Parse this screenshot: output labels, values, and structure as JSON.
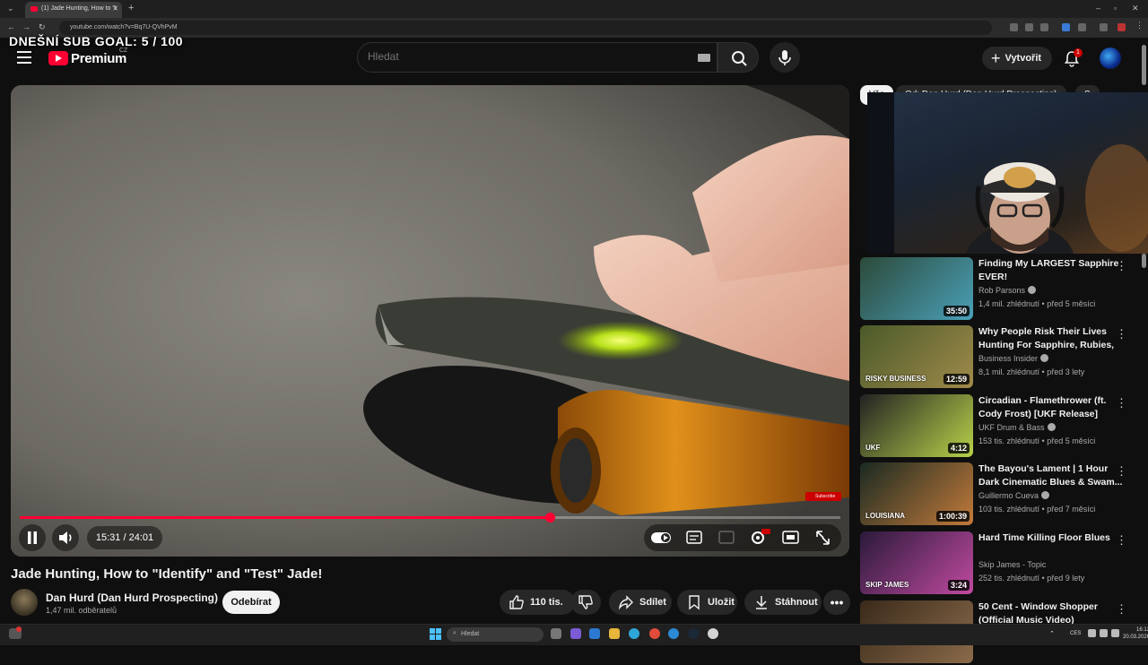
{
  "browser": {
    "tab_title": "(1) Jade Hunting, How to \"I",
    "url": "youtube.com/watch?v=Bq7U-QVhPvM"
  },
  "overlay": {
    "sub_goal": "DNEŠNÍ SUB GOAL:  5 / 100"
  },
  "header": {
    "logo_text": "Premium",
    "logo_country": "CZ",
    "search_placeholder": "Hledat",
    "create_label": "Vytvořit",
    "notification_count": "1"
  },
  "player": {
    "time": "15:31 / 24:01",
    "progress": 0.646,
    "subscribe_watermark": "Subscribe"
  },
  "video": {
    "title": "Jade Hunting, How to \"Identify\" and \"Test\" Jade!",
    "channel": "Dan Hurd (Dan Hurd Prospecting)",
    "subscribers": "1,47 mil. odběratelů",
    "subscribe_label": "Odebírat",
    "likes": "110 tis.",
    "share_label": "Sdílet",
    "save_label": "Uložit",
    "download_label": "Stáhnout"
  },
  "sidebar": {
    "chips": [
      "Vše",
      "Od: Dan Hurd (Dan Hurd Prospecting)",
      "S"
    ],
    "recommendations": [
      {
        "title": "Finding My LARGEST Sapphire EVER!",
        "channel": "Rob Parsons",
        "verified": true,
        "meta": "1,4 mil. zhlédnutí • před 5 měsíci",
        "duration": "35:50",
        "thumb_colors": [
          "#2c4a3a",
          "#4aa0b8"
        ]
      },
      {
        "title": "Why People Risk Their Lives Hunting For Sapphire, Rubies, ...",
        "channel": "Business Insider",
        "verified": true,
        "meta": "8,1 mil. zhlédnutí • před 3 lety",
        "duration": "12:59",
        "thumb_colors": [
          "#4a5a2a",
          "#a08a4a"
        ],
        "thumb_caption": "RISKY BUSINESS"
      },
      {
        "title": "Circadian - Flamethrower (ft. Cody Frost) [UKF Release]",
        "channel": "UKF Drum & Bass",
        "verified": true,
        "meta": "153 tis. zhlédnutí • před 5 měsíci",
        "duration": "4:12",
        "thumb_colors": [
          "#222222",
          "#b8d24a"
        ],
        "thumb_caption": "UKF"
      },
      {
        "title": "The Bayou's Lament | 1 Hour Dark Cinematic Blues & Swam...",
        "channel": "Guillermo Cueva",
        "verified": true,
        "meta": "103 tis. zhlédnutí • před 7 měsíci",
        "duration": "1:00:39",
        "thumb_colors": [
          "#1a2a22",
          "#c27a3a"
        ],
        "thumb_caption": "LOUISIANA"
      },
      {
        "title": "Hard Time Killing Floor Blues",
        "channel": "Skip James - Topic",
        "verified": false,
        "meta": "252 tis. zhlédnutí • před 9 lety",
        "duration": "3:24",
        "thumb_colors": [
          "#2a1a3a",
          "#c04aa0"
        ],
        "thumb_caption": "SKIP JAMES"
      },
      {
        "title": "50 Cent - Window Shopper (Official Music Video)",
        "channel": "",
        "verified": false,
        "meta": "",
        "duration": "",
        "thumb_colors": [
          "#3a2a1a",
          "#8a6a4a"
        ]
      }
    ]
  },
  "taskbar": {
    "search_placeholder": "Hledat",
    "language": "CES",
    "time": "16:12",
    "date": "20.03.2026"
  }
}
